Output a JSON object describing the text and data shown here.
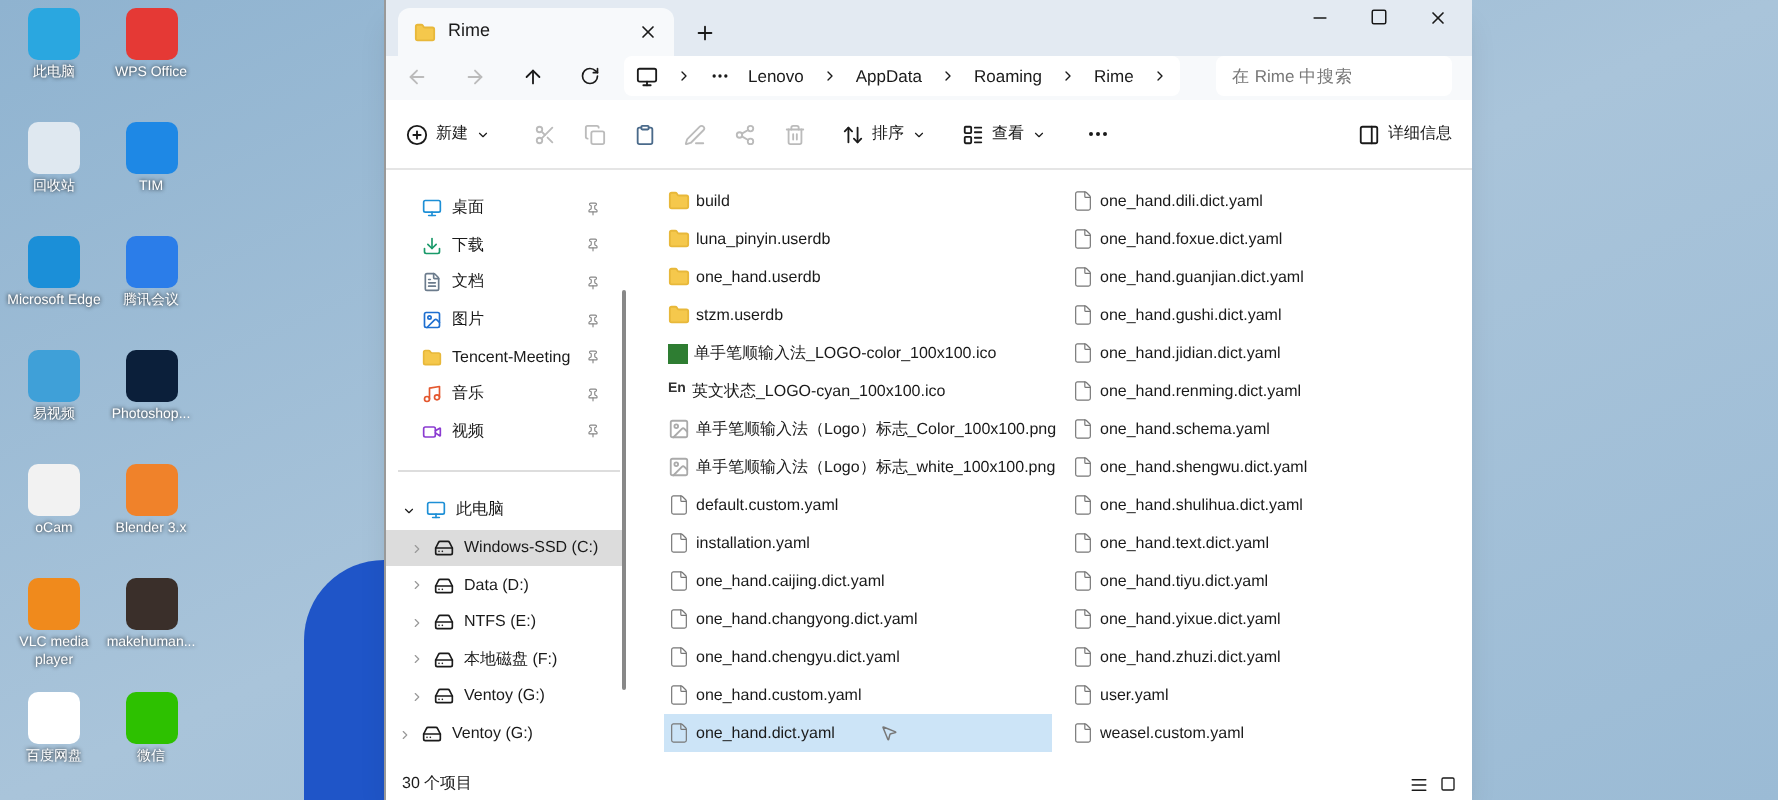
{
  "desktop_icons": [
    {
      "label": "此电脑",
      "kind": "monitor"
    },
    {
      "label": "WPS Office",
      "kind": "wps"
    },
    {
      "label": "回收站",
      "kind": "bin"
    },
    {
      "label": "TIM",
      "kind": "tim"
    },
    {
      "label": "Microsoft Edge",
      "kind": "edge"
    },
    {
      "label": "腾讯会议",
      "kind": "meeting"
    },
    {
      "label": "易视频",
      "kind": "chart"
    },
    {
      "label": "Photoshop...",
      "kind": "ps"
    },
    {
      "label": "oCam",
      "kind": "ocam"
    },
    {
      "label": "Blender 3.x",
      "kind": "blender"
    },
    {
      "label": "VLC media player",
      "kind": "vlc"
    },
    {
      "label": "makehuman...",
      "kind": "human"
    },
    {
      "label": "百度网盘",
      "kind": "cloud"
    },
    {
      "label": "微信",
      "kind": "wechat"
    }
  ],
  "window": {
    "tab_title": "Rime",
    "breadcrumb": [
      "Lenovo",
      "AppData",
      "Roaming",
      "Rime"
    ],
    "search": {
      "placeholder": "在 Rime 中搜索"
    },
    "toolbar": [
      {
        "label": "新建",
        "kind": "new"
      },
      {
        "label": "排序",
        "kind": "sort"
      },
      {
        "label": "查看",
        "kind": "view"
      }
    ],
    "details_button": "详细信息",
    "sidebar": {
      "quick_access": [
        {
          "label": "桌面",
          "kind": "desktop"
        },
        {
          "label": "下载",
          "kind": "download"
        },
        {
          "label": "文档",
          "kind": "doc"
        },
        {
          "label": "图片",
          "kind": "pic"
        },
        {
          "label": "Tencent-Meeting",
          "kind": "folder"
        },
        {
          "label": "音乐",
          "kind": "music"
        },
        {
          "label": "视频",
          "kind": "video"
        }
      ],
      "this_pc": {
        "label": "此电脑",
        "expanded": true,
        "children": [
          {
            "label": "Windows-SSD (C:)",
            "selected": true
          },
          {
            "label": "Data (D:)",
            "selected": false
          },
          {
            "label": "NTFS (E:)",
            "selected": false
          },
          {
            "label": "本地磁盘 (F:)",
            "selected": false
          },
          {
            "label": "Ventoy (G:)",
            "selected": false
          }
        ]
      },
      "more": [
        {
          "label": "Ventoy (G:)"
        }
      ]
    },
    "files": [
      {
        "name": "build",
        "kind": "folder",
        "selected": false
      },
      {
        "name": "luna_pinyin.userdb",
        "kind": "folder",
        "selected": false
      },
      {
        "name": "one_hand.userdb",
        "kind": "folder",
        "selected": false
      },
      {
        "name": "stzm.userdb",
        "kind": "folder",
        "selected": false
      },
      {
        "name": "单手笔顺输入法_LOGO-color_100x100.ico",
        "kind": "ico",
        "selected": false
      },
      {
        "name": "英文状态_LOGO-cyan_100x100.ico",
        "kind": "en",
        "icon_text": "En",
        "selected": false
      },
      {
        "name": "单手笔顺输入法（Logo）标志_Color_100x100.png",
        "kind": "image",
        "selected": false
      },
      {
        "name": "单手笔顺输入法（Logo）标志_white_100x100.png",
        "kind": "image",
        "selected": false
      },
      {
        "name": "default.custom.yaml",
        "kind": "file",
        "selected": false
      },
      {
        "name": "installation.yaml",
        "kind": "file",
        "selected": false
      },
      {
        "name": "one_hand.caijing.dict.yaml",
        "kind": "file",
        "selected": false
      },
      {
        "name": "one_hand.changyong.dict.yaml",
        "kind": "file",
        "selected": false
      },
      {
        "name": "one_hand.chengyu.dict.yaml",
        "kind": "file",
        "selected": false
      },
      {
        "name": "one_hand.custom.yaml",
        "kind": "file",
        "selected": false
      },
      {
        "name": "one_hand.dict.yaml",
        "kind": "file",
        "selected": true
      },
      {
        "name": "one_hand.dili.dict.yaml",
        "kind": "file",
        "selected": false
      },
      {
        "name": "one_hand.foxue.dict.yaml",
        "kind": "file",
        "selected": false
      },
      {
        "name": "one_hand.guanjian.dict.yaml",
        "kind": "file",
        "selected": false
      },
      {
        "name": "one_hand.gushi.dict.yaml",
        "kind": "file",
        "selected": false
      },
      {
        "name": "one_hand.jidian.dict.yaml",
        "kind": "file",
        "selected": false
      },
      {
        "name": "one_hand.renming.dict.yaml",
        "kind": "file",
        "selected": false
      },
      {
        "name": "one_hand.schema.yaml",
        "kind": "file",
        "selected": false
      },
      {
        "name": "one_hand.shengwu.dict.yaml",
        "kind": "file",
        "selected": false
      },
      {
        "name": "one_hand.shulihua.dict.yaml",
        "kind": "file",
        "selected": false
      },
      {
        "name": "one_hand.text.dict.yaml",
        "kind": "file",
        "selected": false
      },
      {
        "name": "one_hand.tiyu.dict.yaml",
        "kind": "file",
        "selected": false
      },
      {
        "name": "one_hand.yixue.dict.yaml",
        "kind": "file",
        "selected": false
      },
      {
        "name": "one_hand.zhuzi.dict.yaml",
        "kind": "file",
        "selected": false
      },
      {
        "name": "user.yaml",
        "kind": "file",
        "selected": false
      },
      {
        "name": "weasel.custom.yaml",
        "kind": "file",
        "selected": false
      }
    ],
    "status": "30 个项目"
  }
}
